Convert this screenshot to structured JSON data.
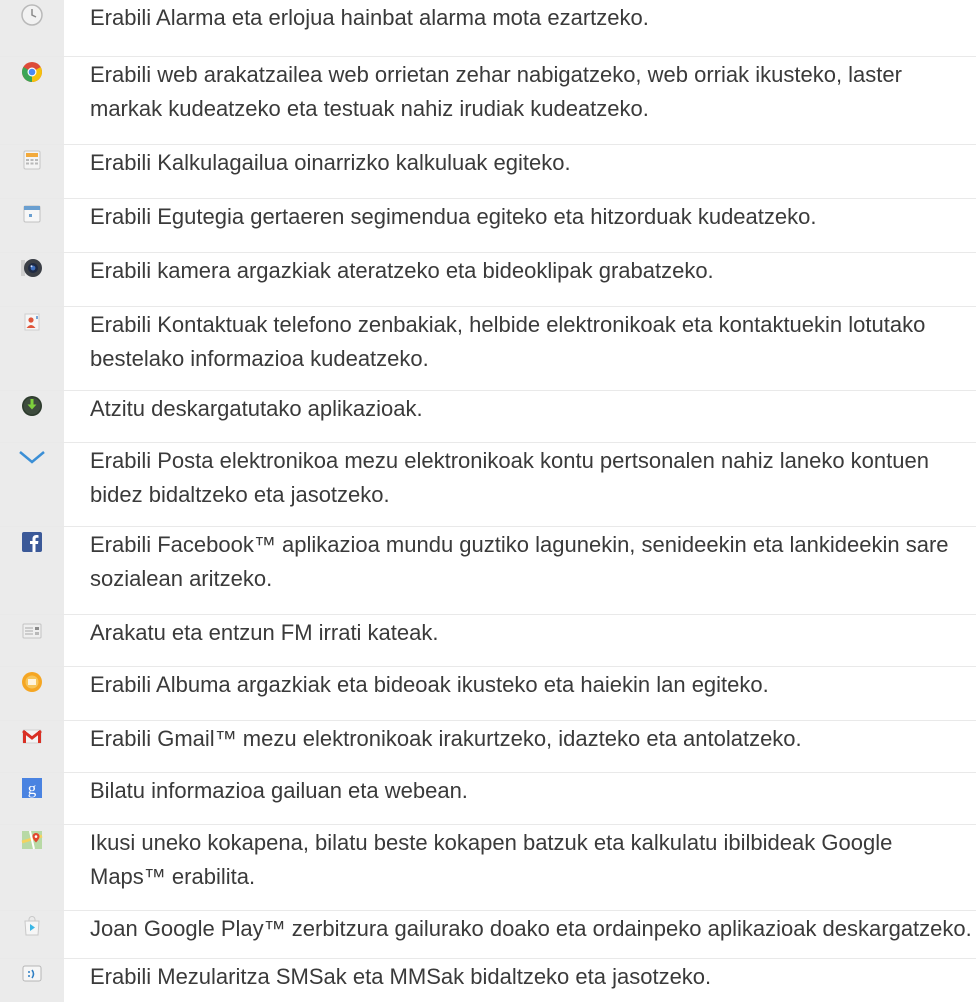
{
  "items": [
    {
      "icon": "clock-icon",
      "text": "Erabili Alarma eta erlojua hainbat alarma mota ezartzeko."
    },
    {
      "icon": "chrome-icon",
      "text": "Erabili web arakatzailea web orrietan zehar nabigatzeko, web orriak ikusteko, laster markak kudeatzeko eta testuak nahiz irudiak kudeatzeko."
    },
    {
      "icon": "calculator-icon",
      "text": "Erabili Kalkulagailua oinarrizko kalkuluak egiteko."
    },
    {
      "icon": "calendar-icon",
      "text": "Erabili Egutegia gertaeren segimendua egiteko eta hitzorduak kudeatzeko."
    },
    {
      "icon": "camera-icon",
      "text": "Erabili kamera argazkiak ateratzeko eta bideoklipak grabatzeko."
    },
    {
      "icon": "contacts-icon",
      "text": "Erabili Kontaktuak telefono zenbakiak, helbide elektronikoak eta kontaktuekin lotutako bestelako informazioa kudeatzeko."
    },
    {
      "icon": "download-icon",
      "text": "Atzitu deskargatutako aplikazioak."
    },
    {
      "icon": "email-icon",
      "text": "Erabili Posta elektronikoa mezu elektronikoak kontu pertsonalen nahiz laneko kontuen bidez bidaltzeko eta jasotzeko."
    },
    {
      "icon": "facebook-icon",
      "text": "Erabili Facebook™ aplikazioa mundu guztiko lagunekin, senideekin eta lankideekin sare sozialean aritzeko."
    },
    {
      "icon": "radio-icon",
      "text": "Arakatu eta entzun FM irrati kateak."
    },
    {
      "icon": "album-icon",
      "text": "Erabili Albuma argazkiak eta bideoak ikusteko eta haiekin lan egiteko."
    },
    {
      "icon": "gmail-icon",
      "text": "Erabili Gmail™ mezu elektronikoak irakurtzeko, idazteko eta antolatzeko."
    },
    {
      "icon": "google-search-icon",
      "text": "Bilatu informazioa gailuan eta webean."
    },
    {
      "icon": "maps-icon",
      "text": "Ikusi uneko kokapena, bilatu beste kokapen batzuk eta kalkulatu ibilbideak Google Maps™ erabilita."
    },
    {
      "icon": "play-store-icon",
      "text": "Joan Google Play™ zerbitzura gailurako doako eta ordainpeko aplikazioak deskargatzeko."
    },
    {
      "icon": "messaging-icon",
      "text": "Erabili Mezularitza SMSak eta MMSak bidaltzeko eta jasotzeko."
    }
  ]
}
